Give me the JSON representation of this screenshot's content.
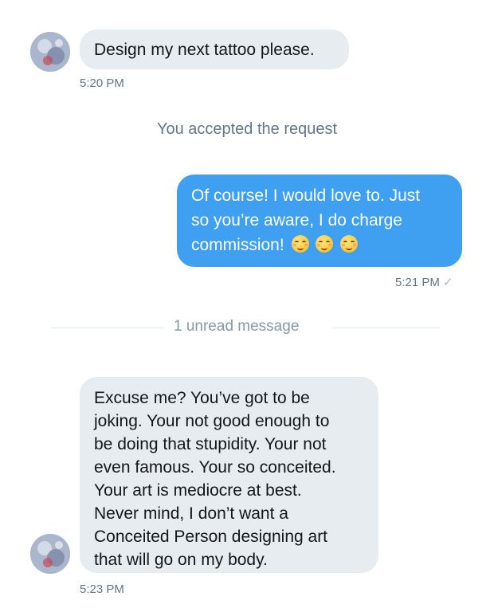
{
  "messages": {
    "first": {
      "text": "Design my next tattoo please.",
      "time": "5:20 PM"
    },
    "system_notice": "You accepted the request",
    "reply": {
      "line1": "Of course! I would love to. Just",
      "line2": "so you’re aware, I do charge",
      "line3": "commission!",
      "emoji_icon": "smiling-face-icon",
      "emoji_count": 3,
      "time": "5:21 PM",
      "status_icon": "check-icon"
    },
    "unread_divider": "1 unread message",
    "second": {
      "lines": [
        "Excuse me? You’ve got to be",
        "joking. Your not good enough to",
        "be doing that stupidity. Your not",
        "even famous. Your so conceited.",
        "Your art is mediocre at best.",
        "Never mind, I don’t want a",
        "Conceited Person designing art",
        "that will go on my body."
      ],
      "time": "5:23 PM"
    }
  },
  "colors": {
    "incoming_bubble": "#e6ecf0",
    "outgoing_bubble": "#3f9ff0",
    "timestamp": "#657786"
  }
}
